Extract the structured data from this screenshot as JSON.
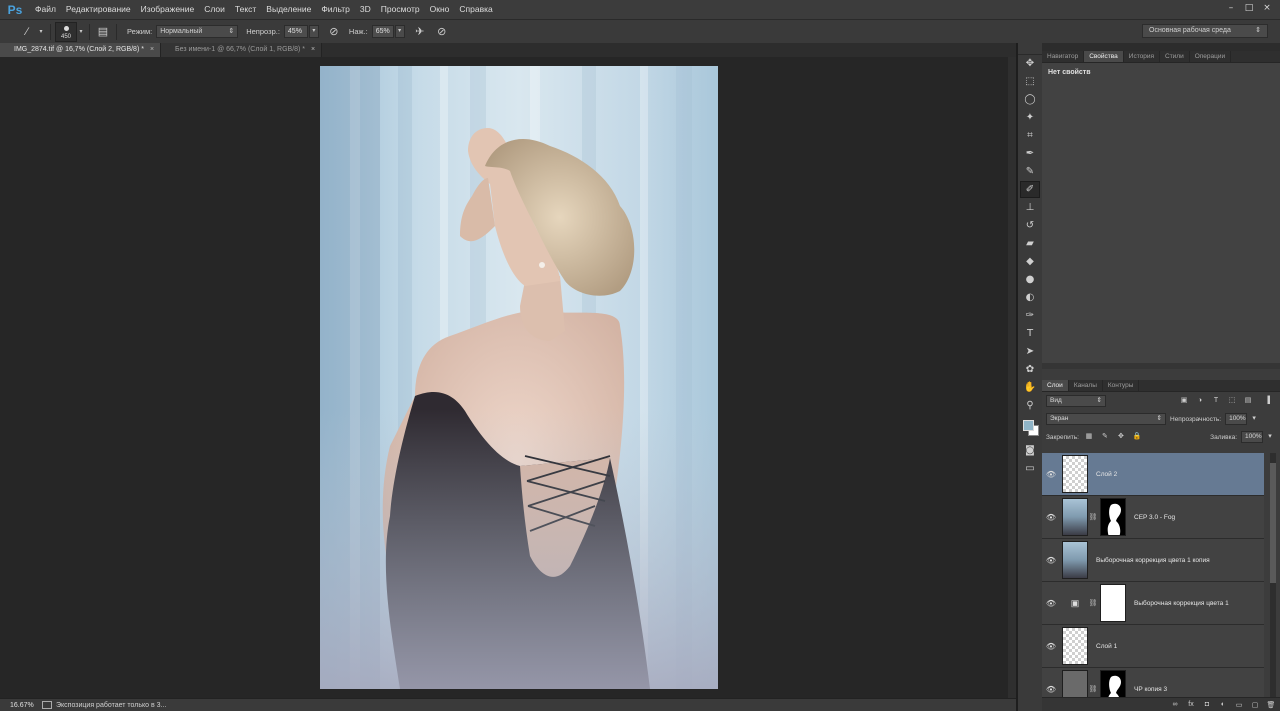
{
  "app": {
    "logo": "Ps"
  },
  "menu": [
    "Файл",
    "Редактирование",
    "Изображение",
    "Слои",
    "Текст",
    "Выделение",
    "Фильтр",
    "3D",
    "Просмотр",
    "Окно",
    "Справка"
  ],
  "window_controls": [
    "–",
    "□",
    "×"
  ],
  "options": {
    "brush_size": "450",
    "mode_label": "Режим:",
    "mode_value": "Нормальный",
    "opacity_label": "Непрозр.:",
    "opacity_value": "45%",
    "flow_label": "Наж.:",
    "flow_value": "65%",
    "workspace": "Основная рабочая среда"
  },
  "tabs": [
    {
      "label": "IMG_2874.tif @ 16,7% (Слой 2, RGB/8) *",
      "active": true
    },
    {
      "label": "Без имени-1 @ 66,7% (Слой 1, RGB/8) *",
      "active": false
    }
  ],
  "status": {
    "zoom": "16.67%",
    "text": "Экспозиция работает только в 3..."
  },
  "tools": [
    "move-tool",
    "marquee-tool",
    "lasso-tool",
    "magic-wand-tool",
    "crop-tool",
    "eyedropper-tool",
    "healing-brush-tool",
    "brush-tool",
    "clone-stamp-tool",
    "history-brush-tool",
    "eraser-tool",
    "paint-bucket-tool",
    "blur-tool",
    "dodge-tool",
    "pen-tool",
    "type-tool",
    "path-selection-tool",
    "shape-tool",
    "hand-tool",
    "zoom-tool"
  ],
  "colors": {
    "foreground": "#8fb4c7",
    "background": "#ffffff",
    "selection": "#667a93"
  },
  "props_panel": {
    "tabs": [
      "Навигатор",
      "Свойства",
      "История",
      "Стили",
      "Операции"
    ],
    "active_tab": 1,
    "empty_text": "Нет свойств"
  },
  "layers_panel": {
    "tabs": [
      "Слои",
      "Каналы",
      "Контуры"
    ],
    "filter": "Вид",
    "blend_mode": "Экран",
    "opacity_label": "Непрозрачность:",
    "opacity_value": "100%",
    "lock_label": "Закрепить:",
    "fill_label": "Заливка:",
    "fill_value": "100%",
    "layers": [
      {
        "name": "Слой 2",
        "thumb": "check",
        "selected": true,
        "mask": null
      },
      {
        "name": "CEP 3.0 - Fog",
        "thumb": "photo",
        "selected": false,
        "mask": "mask"
      },
      {
        "name": "Выборочная коррекция цвета 1 копия",
        "thumb": "photo",
        "selected": false,
        "mask": null
      },
      {
        "name": "Выборочная коррекция цвета 1",
        "thumb": "adjust",
        "selected": false,
        "mask": "white"
      },
      {
        "name": "Слой 1",
        "thumb": "check",
        "selected": false,
        "mask": null
      },
      {
        "name": "ЧР копия 3",
        "thumb": "grey",
        "selected": false,
        "mask": "mask"
      }
    ]
  }
}
